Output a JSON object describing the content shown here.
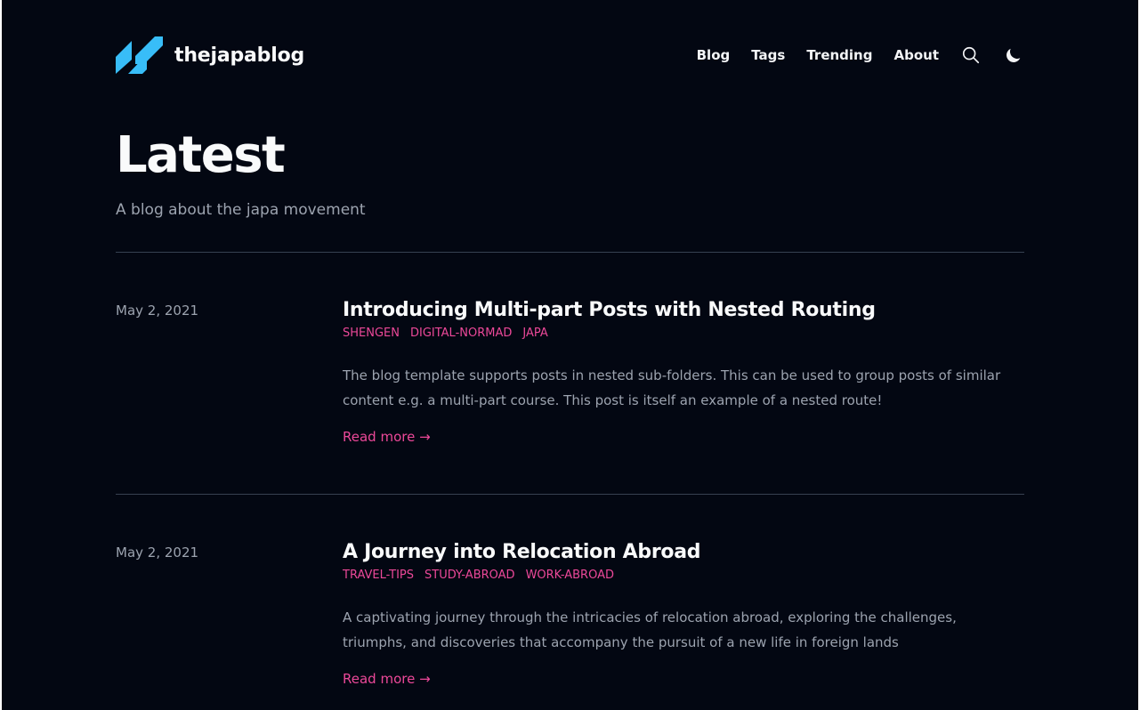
{
  "site": {
    "name": "thejapablog",
    "logo_icon": "logo-icon",
    "accent": "#ec4899",
    "logo_color": "#38bdf8",
    "background": "#030712"
  },
  "nav": {
    "items": [
      {
        "label": "Blog"
      },
      {
        "label": "Tags"
      },
      {
        "label": "Trending"
      },
      {
        "label": "About"
      }
    ],
    "search_icon": "search-icon",
    "theme_icon": "moon-icon"
  },
  "hero": {
    "title": "Latest",
    "subtitle": "A blog about the japa movement"
  },
  "posts": [
    {
      "date": "May 2, 2021",
      "title": "Introducing Multi-part Posts with Nested Routing",
      "tags": [
        "SHENGEN",
        "DIGITAL-NORMAD",
        "JAPA"
      ],
      "summary": "The blog template supports posts in nested sub-folders. This can be used to group posts of similar content e.g. a multi-part course. This post is itself an example of a nested route!",
      "read_more": "Read more →"
    },
    {
      "date": "May 2, 2021",
      "title": "A Journey into Relocation Abroad",
      "tags": [
        "TRAVEL-TIPS",
        "STUDY-ABROAD",
        "WORK-ABROAD"
      ],
      "summary": "A captivating journey through the intricacies of relocation abroad, exploring the challenges, triumphs, and discoveries that accompany the pursuit of a new life in foreign lands",
      "read_more": "Read more →"
    }
  ]
}
